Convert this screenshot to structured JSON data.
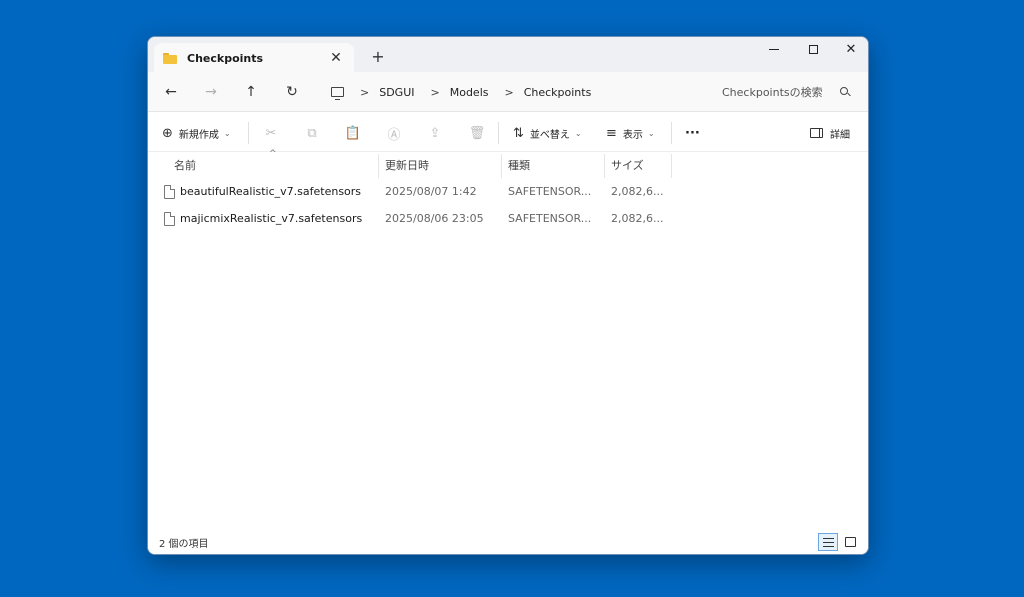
{
  "window": {
    "tab_title": "Checkpoints",
    "tab_close": "✕",
    "new_tab": "+"
  },
  "controls": {
    "minimize": "—",
    "maximize": "☐",
    "close": "✕"
  },
  "nav": {
    "back": "←",
    "forward": "→",
    "up": "↑",
    "refresh": "↻",
    "crumbs": [
      "SDGUI",
      "Models",
      "Checkpoints"
    ],
    "separator": ">",
    "search_placeholder": "Checkpointsの検索"
  },
  "toolbar": {
    "new_label": "新規作成",
    "new_icon": "⊕",
    "chevron": "⌄",
    "sort_label": "並べ替え",
    "sort_icon": "⇅",
    "view_label": "表示",
    "view_icon": "≡",
    "more": "···",
    "details_label": "詳細",
    "cut_icon": "✂",
    "copy_icon": "⧉",
    "paste_icon": "📋",
    "rename_icon": "Ⓐ",
    "share_icon": "⇪",
    "delete_icon": "🗑"
  },
  "columns": {
    "name": "名前",
    "modified": "更新日時",
    "type": "種類",
    "size": "サイズ",
    "sort_indicator": "^"
  },
  "files": [
    {
      "name": "beautifulRealistic_v7.safetensors",
      "modified": "2025/08/07 1:42",
      "type": "SAFETENSOR...",
      "size": "2,082,6..."
    },
    {
      "name": "majicmixRealistic_v7.safetensors",
      "modified": "2025/08/06 23:05",
      "type": "SAFETENSOR...",
      "size": "2,082,6..."
    }
  ],
  "status": {
    "count": "2 個の項目"
  },
  "colors": {
    "desktop": "#0067c0",
    "folder": "#f5c33b",
    "accent": "#6aa6e0"
  }
}
